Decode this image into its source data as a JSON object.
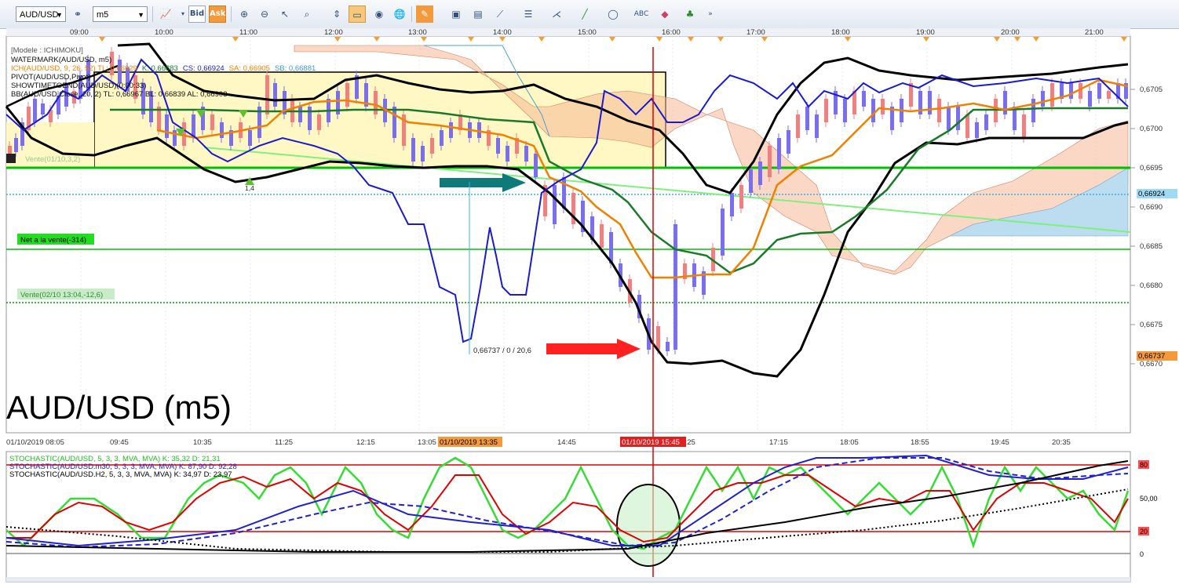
{
  "toolbar": {
    "symbol": "AUD/USD",
    "link_icon": "link-icon",
    "timeframe": "m5",
    "bid_label": "Bid",
    "ask_label": "Ask"
  },
  "time_axis_top": [
    "09:00",
    "10:00",
    "11:00",
    "12:00",
    "13:00",
    "14:00",
    "15:00",
    "16:00",
    "17:00",
    "18:00",
    "19:00",
    "20:00",
    "21:00"
  ],
  "time_axis_bottom": [
    "01/10/2019 08:05",
    "09:45",
    "10:35",
    "11:25",
    "12:15",
    "13:05",
    "14:45",
    "16:25",
    "17:15",
    "18:05",
    "18:55",
    "19:45",
    "20:35"
  ],
  "crosshair_labels": [
    "01/10/2019 13:35",
    "01/10/2019 15:45"
  ],
  "price_axis": [
    "0,6705",
    "0,6700",
    "0,6695",
    "0,6690",
    "0,6685",
    "0,6680",
    "0,6675",
    "0,6670"
  ],
  "price_tags": {
    "blue": "0,66924",
    "orange": "0,66737"
  },
  "info_lines": [
    "[Modele : ICHIMOKU]",
    "WATERMARK(AUD/USD, m5)",
    "PIVOT(AUD/USD,Pivot)",
    "SHOWTIMETOEND(AUD/USD)(0:00:33)",
    "BB(AUD/USD.Close, 20, 2)  TL: 0,66967  BL: 0,66839  AL: 0,66903"
  ],
  "ichimoku_line": {
    "prefix": "ICH(AUD/USD, 9, 26, 52)  TL: 0,66929",
    "k": "K: 0,66883",
    "cs": "CS: 0,66924",
    "sa": "SA: 0,66905",
    "sb": "SB: 0,66881"
  },
  "order_labels": {
    "vente1": "Vente(01/10,3,2)",
    "net": "Net a la vente(-314)",
    "vente2": "Vente(02/10 13:04,-12,6)",
    "low_note": "0,66737 / 0 / 20,6",
    "arrow_count": "1,4"
  },
  "watermark": "AUD/USD (m5)",
  "stochastic": {
    "line1": "STOCHASTIC(AUD/USD, 5, 3, 3, MVA, MVA)  K: 35,32  D: 21,31",
    "line2": "STOCHASTIC(AUD/USD.m30, 5, 3, 3, MVA, MVA)  K: 87,90  D: 92,28",
    "line3": "STOCHASTIC(AUD/USD.H2, 5, 3, 3, MVA, MVA)  K: 34,97  D: 23,97",
    "axis": [
      "80",
      "50,00",
      "20",
      "0"
    ]
  },
  "colors": {
    "price_blue": "#1a1ad0",
    "kijun_green": "#1a7a2a",
    "tenkan_orange": "#f08000",
    "bb_black": "#000000",
    "candle_up": "#7a6ef0",
    "candle_down": "#f08080",
    "stoch_green": "#33dd33",
    "stoch_red": "#e00000",
    "level_line": "#00c000",
    "crosshair": "#e00000",
    "cloud_fill": "#f5b896",
    "cloud_blue": "#bcdcf0"
  }
}
